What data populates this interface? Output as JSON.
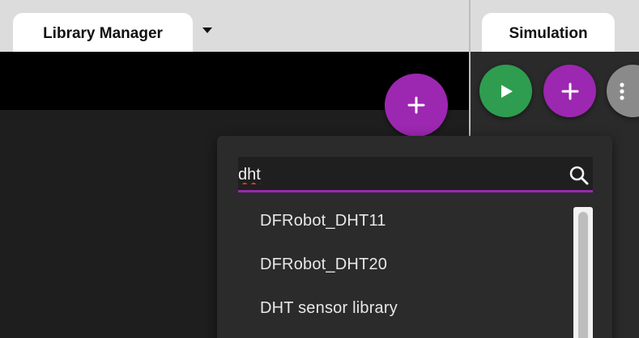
{
  "left_panel": {
    "tab_label": "Library Manager",
    "dropdown_icon": "caret-down-icon",
    "add_library_icon": "plus-icon"
  },
  "right_panel": {
    "tab_label": "Simulation",
    "buttons": [
      {
        "icon": "play-icon",
        "color": "#2e9d4f"
      },
      {
        "icon": "plus-icon",
        "color": "#9c27b0"
      },
      {
        "icon": "more-vertical-icon",
        "color": "#8a8a8a"
      }
    ]
  },
  "library_search": {
    "query": "dht",
    "icon": "search-icon",
    "accent_color": "#9c27b0",
    "results": [
      {
        "label": "DFRobot_DHT11"
      },
      {
        "label": "DFRobot_DHT20"
      },
      {
        "label": "DHT sensor library"
      }
    ]
  }
}
